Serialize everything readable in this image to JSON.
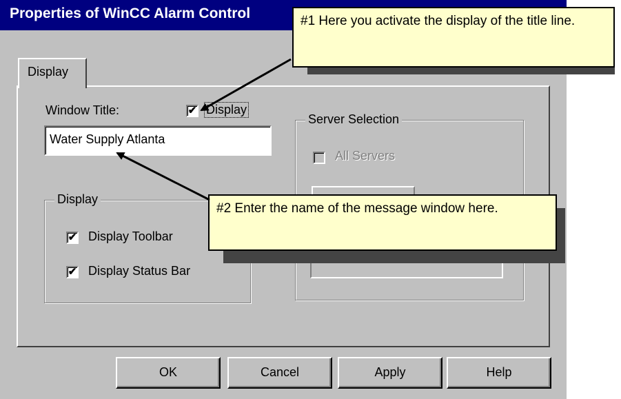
{
  "window": {
    "title": "Properties of WinCC Alarm Control"
  },
  "tabs": [
    {
      "label": "Display"
    }
  ],
  "window_title": {
    "label": "Window Title:",
    "display_checkbox": {
      "label": "Display",
      "checked": true
    },
    "value": "Water Supply Atlanta"
  },
  "display_group": {
    "legend": "Display",
    "toolbar": {
      "label": "Display Toolbar",
      "checked": true
    },
    "statusbar": {
      "label": "Display Status Bar",
      "checked": true
    }
  },
  "server_selection": {
    "legend": "Server Selection",
    "all_servers": {
      "label": "All Servers",
      "checked": false,
      "enabled": false
    }
  },
  "buttons": {
    "ok": "OK",
    "cancel": "Cancel",
    "apply": "Apply",
    "help": "Help"
  },
  "callouts": {
    "c1": "#1 Here you activate the display of the title line.",
    "c2": "#2 Enter the name of the message window here."
  },
  "colors": {
    "titlebar": "#000080",
    "dialog": "#c0c0c0",
    "callout": "#ffffcc"
  },
  "check_glyph": "✔"
}
